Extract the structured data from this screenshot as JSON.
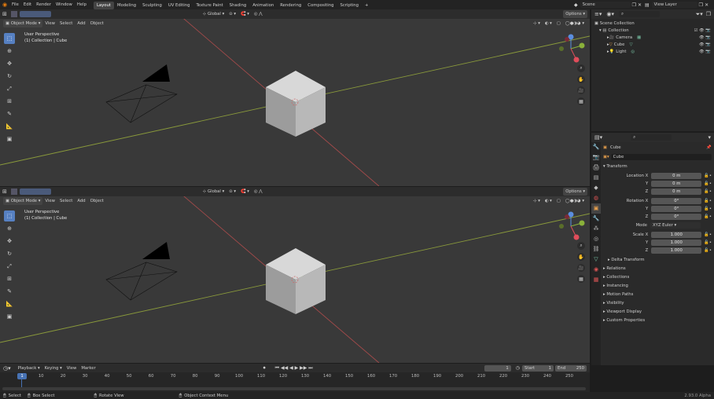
{
  "menubar": {
    "items": [
      "File",
      "Edit",
      "Render",
      "Window",
      "Help"
    ],
    "workspaces": [
      "Layout",
      "Modeling",
      "Sculpting",
      "UV Editing",
      "Texture Paint",
      "Shading",
      "Animation",
      "Rendering",
      "Compositing",
      "Scripting"
    ],
    "active_workspace": "Layout",
    "add_workspace": "+",
    "scene": "Scene",
    "view_layer": "View Layer"
  },
  "viewport_top": {
    "mode": "Object Mode",
    "menus": [
      "View",
      "Select",
      "Add",
      "Object"
    ],
    "transform_orientation": "Global",
    "options": "Options",
    "perspective": "User Perspective",
    "collection_info": "(1) Collection | Cube"
  },
  "viewport_bottom": {
    "mode": "Object Mode",
    "menus": [
      "View",
      "Select",
      "Add",
      "Object"
    ],
    "transform_orientation": "Global",
    "options": "Options",
    "perspective": "User Perspective",
    "collection_info": "(1) Collection | Cube"
  },
  "outliner": {
    "root": "Scene Collection",
    "collection": "Collection",
    "items": [
      "Camera",
      "Cube",
      "Light"
    ]
  },
  "properties": {
    "object_name": "Cube",
    "object_field": "Cube",
    "transform_label": "Transform",
    "location_label": "Location X",
    "location": {
      "x": "0 m",
      "y": "0 m",
      "z": "0 m"
    },
    "rotation_label": "Rotation X",
    "rotation": {
      "x": "0°",
      "y": "0°",
      "z": "0°"
    },
    "mode_label": "Mode",
    "mode_value": "XYZ Euler",
    "scale_label": "Scale X",
    "scale": {
      "x": "1.000",
      "y": "1.000",
      "z": "1.000"
    },
    "y_label": "Y",
    "z_label": "Z",
    "delta": "Delta Transform",
    "panels": [
      "Relations",
      "Collections",
      "Instancing",
      "Motion Paths",
      "Visibility",
      "Viewport Display",
      "Custom Properties"
    ]
  },
  "timeline": {
    "menus": [
      "Playback",
      "Keying",
      "View",
      "Marker"
    ],
    "current_frame": "1",
    "start_label": "Start",
    "start": "1",
    "end_label": "End",
    "end": "250",
    "ticks": [
      "10",
      "20",
      "30",
      "40",
      "50",
      "60",
      "70",
      "80",
      "90",
      "100",
      "110",
      "120",
      "130",
      "140",
      "150",
      "160",
      "170",
      "180",
      "190",
      "200",
      "210",
      "220",
      "230",
      "240",
      "250"
    ],
    "playhead": "1"
  },
  "statusbar": {
    "select": "Select",
    "box_select": "Box Select",
    "rotate_view": "Rotate View",
    "context_menu": "Object Context Menu",
    "version": "2.93.0 Alpha"
  }
}
